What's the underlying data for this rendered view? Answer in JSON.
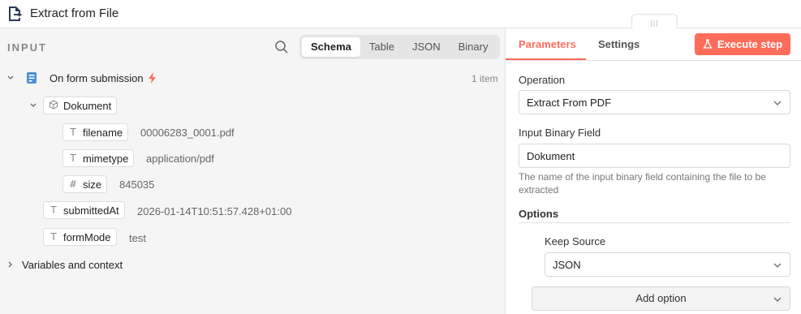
{
  "header": {
    "title": "Extract from File",
    "icon": "extract-file-icon"
  },
  "input": {
    "label": "INPUT",
    "tabs": [
      "Schema",
      "Table",
      "JSON",
      "Binary"
    ],
    "active_tab": "Schema",
    "node": {
      "name": "On form submission",
      "count": "1 item"
    },
    "tree": {
      "dokument": "Dokument",
      "filename": {
        "key": "filename",
        "value": "00006283_0001.pdf",
        "type_icon": "T"
      },
      "mimetype": {
        "key": "mimetype",
        "value": "application/pdf",
        "type_icon": "T"
      },
      "size": {
        "key": "size",
        "value": "845035",
        "type_icon": "#"
      },
      "submittedAt": {
        "key": "submittedAt",
        "value": "2026-01-14T10:51:57.428+01:00",
        "type_icon": "T"
      },
      "formMode": {
        "key": "formMode",
        "value": "test",
        "type_icon": "T"
      }
    },
    "variables": "Variables and context"
  },
  "params": {
    "tabs": {
      "parameters": "Parameters",
      "settings": "Settings"
    },
    "execute": "Execute step",
    "operation": {
      "label": "Operation",
      "value": "Extract From PDF"
    },
    "binary_field": {
      "label": "Input Binary Field",
      "value": "Dokument",
      "hint": "The name of the input binary field containing the file to be extracted"
    },
    "options": {
      "label": "Options",
      "keep_source": {
        "label": "Keep Source",
        "value": "JSON"
      },
      "add": "Add option"
    }
  },
  "colors": {
    "accent": "#ff6d5a",
    "icon_blue": "#4b8fd3"
  }
}
